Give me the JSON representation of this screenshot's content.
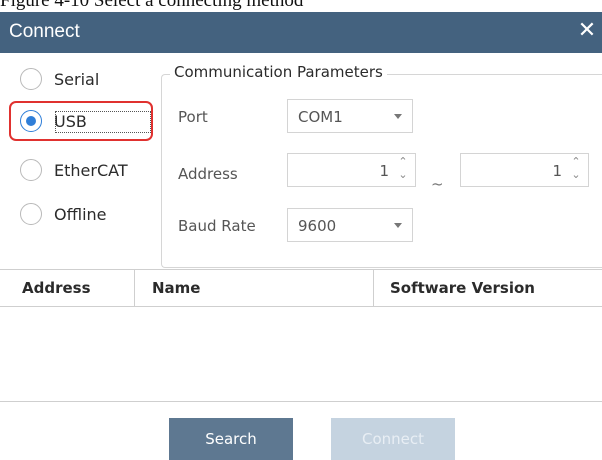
{
  "caption": "Figure 4-10 Select a connecting method",
  "window": {
    "title": "Connect",
    "close_glyph": "✕"
  },
  "connection_types": [
    {
      "label": "Serial",
      "selected": false
    },
    {
      "label": "USB",
      "selected": true
    },
    {
      "label": "EtherCAT",
      "selected": false
    },
    {
      "label": "Offline",
      "selected": false
    }
  ],
  "params": {
    "legend": "Communication Parameters",
    "port": {
      "label": "Port",
      "value": "COM1"
    },
    "address": {
      "label": "Address",
      "from": "1",
      "to": "1",
      "separator": "~"
    },
    "baud_rate": {
      "label": "Baud Rate",
      "value": "9600"
    }
  },
  "table": {
    "columns": [
      "Address",
      "Name",
      "Software Version"
    ],
    "rows": []
  },
  "buttons": {
    "search": "Search",
    "connect": "Connect"
  },
  "colors": {
    "titlebar": "#44627f",
    "primary_button": "#5e7891",
    "disabled_button": "#c5d3e0",
    "radio_selected": "#2f7ed8",
    "highlight": "#e0312f"
  },
  "icons": {
    "close": "close-icon",
    "dropdown": "chevron-down-icon",
    "spin_up": "chevron-up-icon",
    "spin_down": "chevron-down-icon"
  }
}
